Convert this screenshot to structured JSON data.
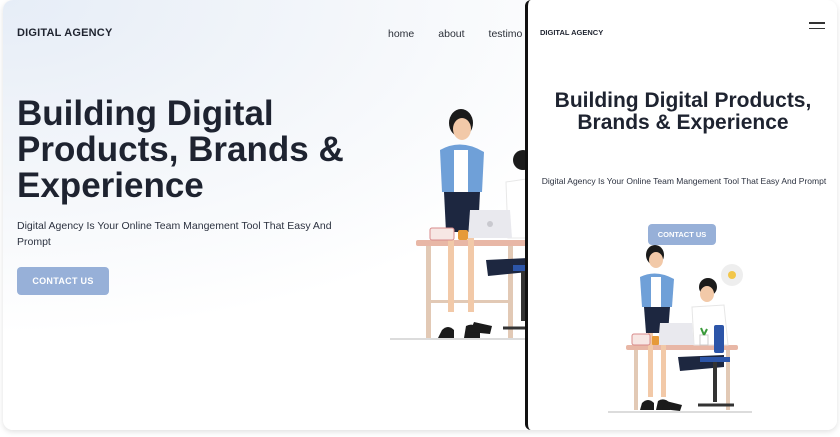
{
  "desktop": {
    "brand": "DIGITAL AGENCY",
    "nav": [
      "home",
      "about",
      "testimo"
    ],
    "hero_title": "Building Digital Products, Brands & Experience",
    "hero_subtitle": "Digital Agency Is Your Online Team Mangement Tool That Easy And Prompt",
    "cta_label": "CONTACT US"
  },
  "mobile": {
    "brand": "DIGITAL AGENCY",
    "menu_icon": "hamburger-menu-icon",
    "hero_title": "Building Digital Products, Brands & Experience",
    "hero_subtitle": "Digital Agency Is Your Online Team Mangement Tool That Easy And Prompt",
    "cta_label": "CONTACT US"
  },
  "colors": {
    "accent": "#97b0d8",
    "heading": "#1e2330",
    "text": "#2c3240"
  }
}
